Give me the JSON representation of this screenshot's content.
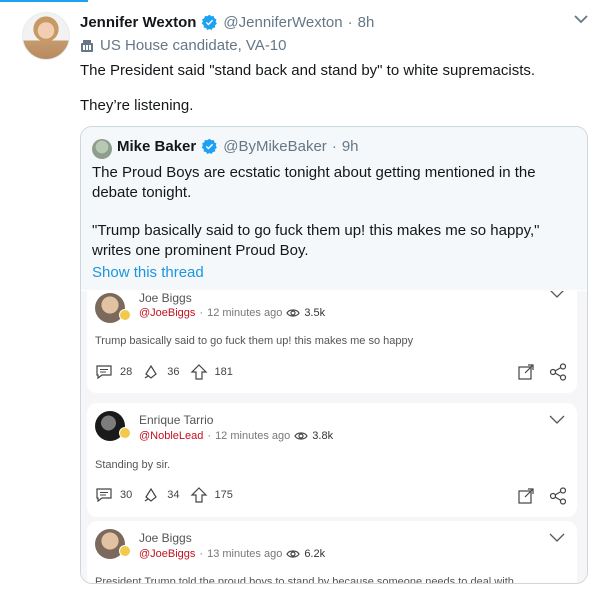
{
  "tweet": {
    "name": "Jennifer Wexton",
    "handle": "@JenniferWexton",
    "time": "8h",
    "label": "US House candidate, VA-10",
    "text_line1": "The President said \"stand back and stand by\" to white supremacists.",
    "text_line2": "They’re listening."
  },
  "quoted": {
    "name": "Mike Baker",
    "handle": "@ByMikeBaker",
    "time": "9h",
    "body_line1": "The Proud Boys are ecstatic tonight about getting mentioned in the",
    "body_line2": "debate tonight.",
    "body_line3": "\"Trump basically said to go fuck them up! this makes me so happy,\"",
    "body_line4": "writes one prominent Proud Boy.",
    "show_thread": "Show this thread"
  },
  "media_posts": [
    {
      "name": "Joe Biggs",
      "handle": "@JoeBiggs",
      "time": "12 minutes ago",
      "views": "3.5k",
      "text": "Trump basically said to go fuck them up! this makes me so happy",
      "comments": "28",
      "reposts": "36",
      "upvotes": "181"
    },
    {
      "name": "Enrique Tarrio",
      "handle": "@NobleLead",
      "time": "12 minutes ago",
      "views": "3.8k",
      "text": "Standing by sir.",
      "comments": "30",
      "reposts": "34",
      "upvotes": "175"
    },
    {
      "name": "Joe Biggs",
      "handle": "@JoeBiggs",
      "time": "13 minutes ago",
      "views": "6.2k",
      "text": "President Trump told the proud boys to stand by because someone needs to deal with"
    }
  ],
  "icons": {
    "verified": "verified-badge-icon",
    "label": "government-building-icon",
    "more": "chevron-down-icon",
    "views": "eye-icon",
    "comment": "comment-icon",
    "repost": "repost-icon",
    "upvote": "upvote-arrow-icon",
    "expand": "expand-icon",
    "share": "share-icon"
  },
  "colors": {
    "accent": "#1da1f2",
    "link": "#1b95e0",
    "handle_red": "#c1121f"
  }
}
